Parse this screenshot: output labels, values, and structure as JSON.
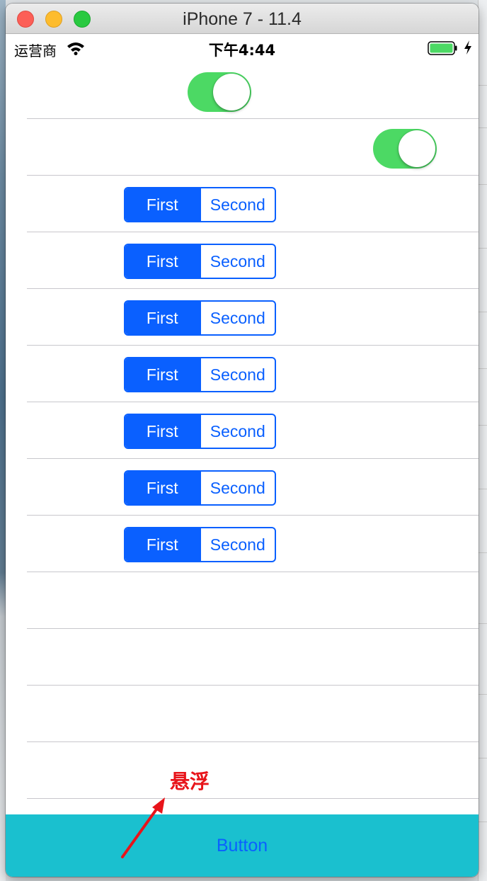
{
  "window": {
    "title": "iPhone 7 - 11.4"
  },
  "status_bar": {
    "carrier": "运营商",
    "time": "下午4:44",
    "battery_color": "#4cd964"
  },
  "switches": [
    {
      "on": true,
      "color": "#4cd964"
    },
    {
      "on": true,
      "color": "#4cd964"
    }
  ],
  "segmented_controls": [
    {
      "segments": [
        "First",
        "Second"
      ],
      "selected": 0
    },
    {
      "segments": [
        "First",
        "Second"
      ],
      "selected": 0
    },
    {
      "segments": [
        "First",
        "Second"
      ],
      "selected": 0
    },
    {
      "segments": [
        "First",
        "Second"
      ],
      "selected": 0
    },
    {
      "segments": [
        "First",
        "Second"
      ],
      "selected": 0
    },
    {
      "segments": [
        "First",
        "Second"
      ],
      "selected": 0
    },
    {
      "segments": [
        "First",
        "Second"
      ],
      "selected": 0
    }
  ],
  "floating_button": {
    "label": "Button",
    "background": "#1ac0cf",
    "text_color": "#0a60ff"
  },
  "annotation": {
    "label": "悬浮",
    "color": "#e8141a"
  },
  "colors": {
    "tint": "#0a60ff",
    "separator": "#c8c7cc"
  }
}
